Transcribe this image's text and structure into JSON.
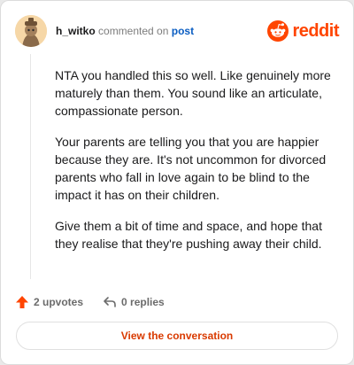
{
  "header": {
    "username": "h_witko",
    "commented_on": "commented on",
    "post_link": "post",
    "brand": "reddit",
    "brand_color": "#ff4500"
  },
  "comment": {
    "paragraphs": [
      "NTA you handled this so well. Like genuinely more maturely than them. You sound like an articulate, compassionate person.",
      "Your parents are telling you that you are happier because they are. It's not uncommon for divorced parents who fall in love again to be blind to the impact it has on their children.",
      "Give them a bit of time and space, and hope that they realise that they're pushing away their child."
    ]
  },
  "actions": {
    "upvotes": "2 upvotes",
    "replies": "0 replies",
    "upvote_icon": "upvote-arrow-icon",
    "reply_icon": "reply-arrow-icon"
  },
  "footer": {
    "view_button": "View the conversation"
  }
}
